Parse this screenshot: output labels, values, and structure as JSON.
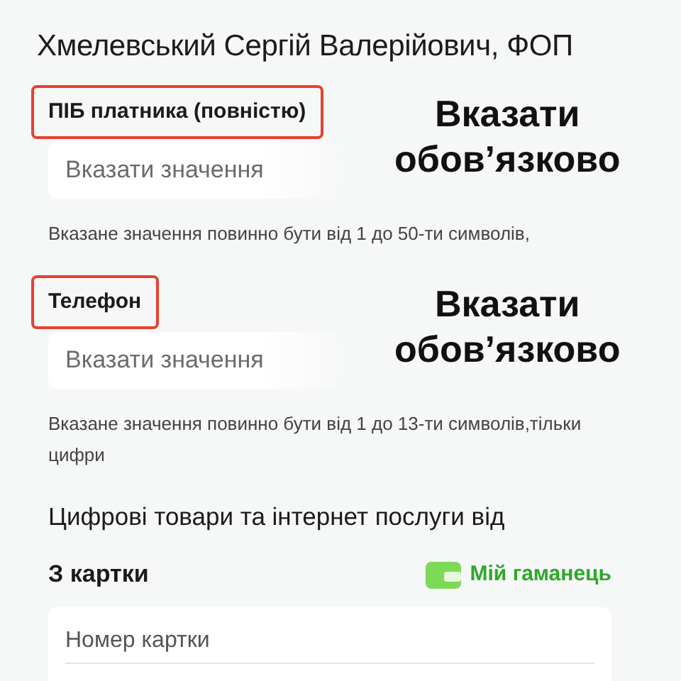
{
  "title": "Хмелевський Сергій Валерійович, ФОП",
  "fields": [
    {
      "label": "ПІБ платника (повністю)",
      "highlighted": true,
      "placeholder": "Вказати значення",
      "annotation": [
        "Вказати",
        "обов’язково"
      ],
      "hint": "Вказане значення повинно бути від 1 до 50-ти символів,"
    },
    {
      "label": "Телефон",
      "highlighted": true,
      "placeholder": "Вказати значення",
      "annotation": [
        "Вказати",
        "обов’язково"
      ],
      "hint": "Вказане значення повинно бути від 1 до 13-ти символів,тільки цифри"
    }
  ],
  "section_title": "Цифрові товари та інтернет послуги від",
  "card_section": {
    "title": "З картки",
    "wallet_link": "Мій гаманець",
    "card_field": {
      "placeholder": "Номер картки"
    }
  }
}
